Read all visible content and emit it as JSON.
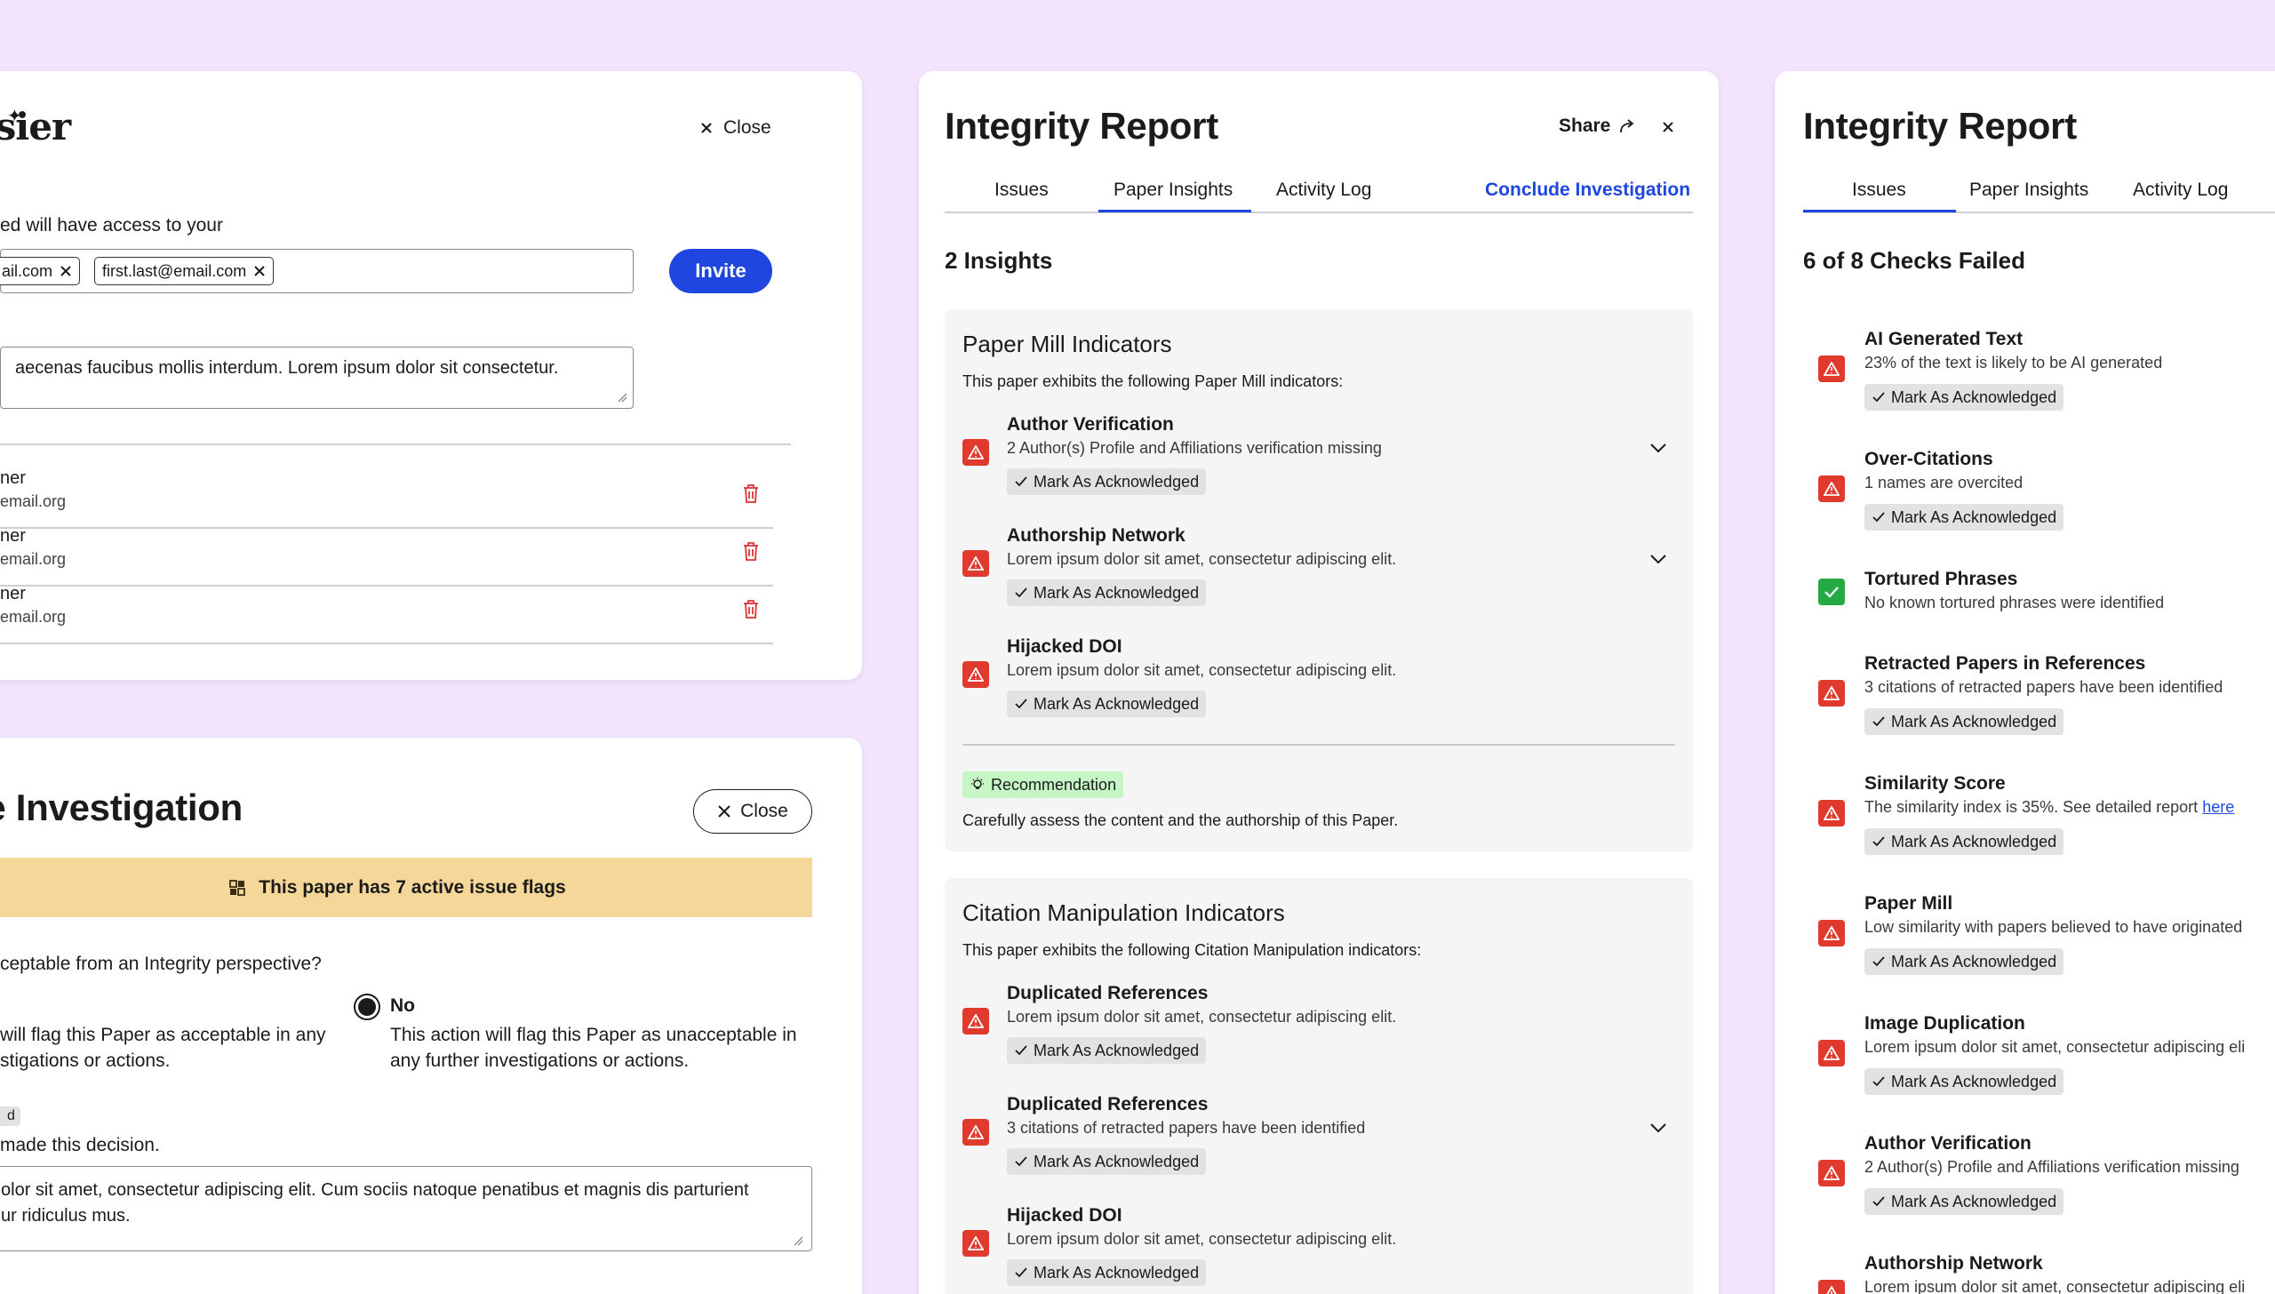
{
  "invite_panel": {
    "logo_text": "ssier",
    "close_label": "Close",
    "access_text": "ed will have access to your",
    "chips": [
      "ail.com",
      "first.last@email.com"
    ],
    "invite_label": "Invite",
    "message": "aecenas faucibus mollis interdum. Lorem ipsum dolor sit consectetur.",
    "members": [
      {
        "name": "ner",
        "email": "email.org"
      },
      {
        "name": "ner",
        "email": "email.org"
      },
      {
        "name": "ner",
        "email": "email.org"
      }
    ]
  },
  "conclude_panel": {
    "title": "le Investigation",
    "close_label": "Close",
    "banner": "This paper has 7 active issue flags",
    "question": "ceptable from an Integrity perspective?",
    "option_yes_text_1": "will flag this Paper as acceptable in any",
    "option_yes_text_2": "stigations or actions.",
    "option_no_label": "No",
    "option_no_text_1": "This action will flag this Paper as unacceptable in",
    "option_no_text_2": "any further investigations or actions.",
    "tag_fragment": "d",
    "decision_label": "made this decision.",
    "reason_line1": "olor sit amet, consectetur adipiscing elit. Cum sociis natoque penatibus et magnis dis parturient",
    "reason_line2": "ur ridiculus mus."
  },
  "insights_panel": {
    "title": "Integrity Report",
    "share_label": "Share",
    "tabs": [
      "Issues",
      "Paper Insights",
      "Activity Log"
    ],
    "active_tab": "Paper Insights",
    "conclude_label": "Conclude Investigation",
    "count_heading": "2 Insights",
    "groups": [
      {
        "title": "Paper Mill Indicators",
        "subtitle": "This paper exhibits the following Paper Mill indicators:",
        "items": [
          {
            "title": "Author Verification",
            "desc": "2 Author(s) Profile and Affiliations verification missing",
            "ack": "Mark As Acknowledged",
            "expandable": true
          },
          {
            "title": "Authorship Network",
            "desc": "Lorem ipsum dolor sit amet, consectetur adipiscing elit.",
            "ack": "Mark As Acknowledged",
            "expandable": true
          },
          {
            "title": "Hijacked DOI",
            "desc": "Lorem ipsum dolor sit amet, consectetur adipiscing elit.",
            "ack": "Mark As Acknowledged",
            "expandable": false
          }
        ],
        "recommendation_label": "Recommendation",
        "recommendation_text": "Carefully assess the content and the authorship of this Paper."
      },
      {
        "title": "Citation Manipulation Indicators",
        "subtitle": "This paper exhibits the following Citation Manipulation indicators:",
        "items": [
          {
            "title": "Duplicated References",
            "desc": "Lorem ipsum dolor sit amet, consectetur adipiscing elit.",
            "ack": "Mark As Acknowledged",
            "expandable": false
          },
          {
            "title": "Duplicated References",
            "desc": "3 citations of retracted papers have been identified",
            "ack": "Mark As Acknowledged",
            "expandable": true
          },
          {
            "title": "Hijacked DOI",
            "desc": "Lorem ipsum dolor sit amet, consectetur adipiscing elit.",
            "ack": "Mark As Acknowledged",
            "expandable": false
          }
        ]
      }
    ]
  },
  "issues_panel": {
    "title": "Integrity Report",
    "tabs": [
      "Issues",
      "Paper Insights",
      "Activity Log"
    ],
    "active_tab": "Issues",
    "count_heading": "6 of 8 Checks Failed",
    "checks": [
      {
        "title": "AI Generated Text",
        "desc": "23% of the text is likely to be AI generated",
        "status": "fail",
        "ack": "Mark As Acknowledged"
      },
      {
        "title": "Over-Citations",
        "desc": "1 names are overcited",
        "status": "fail",
        "ack": "Mark As Acknowledged"
      },
      {
        "title": "Tortured Phrases",
        "desc": "No known tortured phrases were identified",
        "status": "pass",
        "ack": ""
      },
      {
        "title": "Retracted Papers in References",
        "desc": "3 citations of retracted papers have been identified",
        "status": "fail",
        "ack": "Mark As Acknowledged"
      },
      {
        "title": "Similarity Score",
        "desc": "The similarity index is 35%. See detailed report",
        "link": "here",
        "status": "fail",
        "ack": "Mark As Acknowledged"
      },
      {
        "title": "Paper Mill",
        "desc": "Low similarity with papers believed to have originated",
        "status": "fail",
        "ack": "Mark As Acknowledged"
      },
      {
        "title": "Image Duplication",
        "desc": "Lorem ipsum dolor sit amet, consectetur adipiscing eli",
        "status": "fail",
        "ack": "Mark As Acknowledged"
      },
      {
        "title": "Author Verification",
        "desc": "2 Author(s) Profile and Affiliations verification missing",
        "status": "fail",
        "ack": "Mark As Acknowledged"
      },
      {
        "title": "Authorship Network",
        "desc": "Lorem ipsum dolor sit amet, consectetur adipiscing eli",
        "status": "fail",
        "ack": ""
      }
    ]
  },
  "colors": {
    "background": "#f3e3fd",
    "accent": "#1f47e0",
    "warning": "#e03a2f",
    "success": "#26a843",
    "banner": "#f5d79a"
  }
}
